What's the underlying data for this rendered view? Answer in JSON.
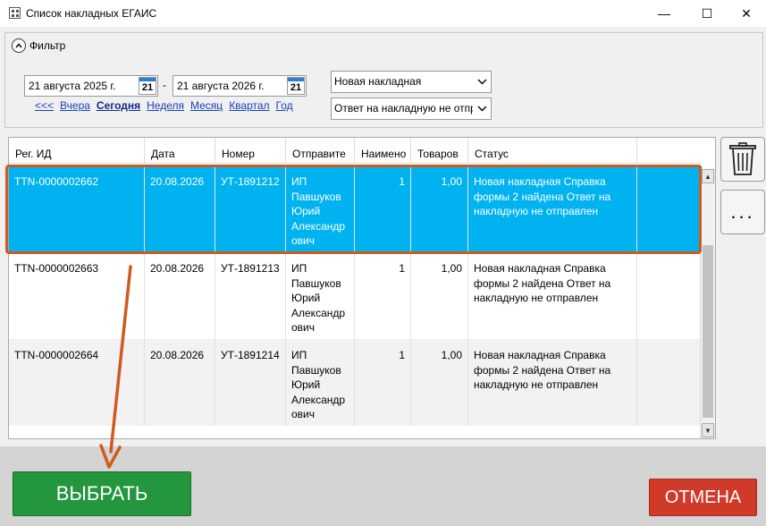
{
  "window": {
    "title": "Список накладных ЕГАИС",
    "minimize": "—",
    "maximize": "☐",
    "close": "✕"
  },
  "filter": {
    "label": "Фильтр",
    "date_from": "21 августа 2025 г.",
    "date_to": "21 августа 2026 г.",
    "calendar_day": "21",
    "dash": "-",
    "periods": [
      "<<<",
      "Вчера",
      "Сегодня",
      "Неделя",
      "Месяц",
      "Квартал",
      "Год"
    ],
    "status_select": "Новая накладная",
    "reply_select": "Ответ на накладную не отправлен"
  },
  "grid": {
    "columns": [
      "Рег. ИД",
      "Дата",
      "Номер",
      "Отправите",
      "Наимено",
      "Товаров",
      "Статус"
    ],
    "rows": [
      {
        "reg_id": "TTN-0000002662",
        "date": "20.08.2026",
        "number": "УТ-1891212",
        "sender": "ИП Павшуков Юрий Александр ович",
        "items": "1",
        "goods": "1,00",
        "status": "Новая накладная Справка формы 2 найдена Ответ на накладную не отправлен"
      },
      {
        "reg_id": "TTN-0000002663",
        "date": "20.08.2026",
        "number": "УТ-1891213",
        "sender": "ИП Павшуков Юрий Александр ович",
        "items": "1",
        "goods": "1,00",
        "status": "Новая накладная Справка формы 2 найдена Ответ на накладную не отправлен"
      },
      {
        "reg_id": "TTN-0000002664",
        "date": "20.08.2026",
        "number": "УТ-1891214",
        "sender": "ИП Павшуков Юрий Александр ович",
        "items": "1",
        "goods": "1,00",
        "status": "Новая накладная Справка формы 2 найдена Ответ на накладную не отправлен"
      }
    ]
  },
  "side": {
    "trash_icon": "trash-icon",
    "more_label": "..."
  },
  "buttons": {
    "select": "ВЫБРАТЬ",
    "cancel": "ОТМЕНА"
  },
  "colors": {
    "selected_row": "#00b3f0",
    "highlight_outline": "#d05a1e",
    "select_button": "#23963e",
    "cancel_button": "#cf3a29"
  }
}
